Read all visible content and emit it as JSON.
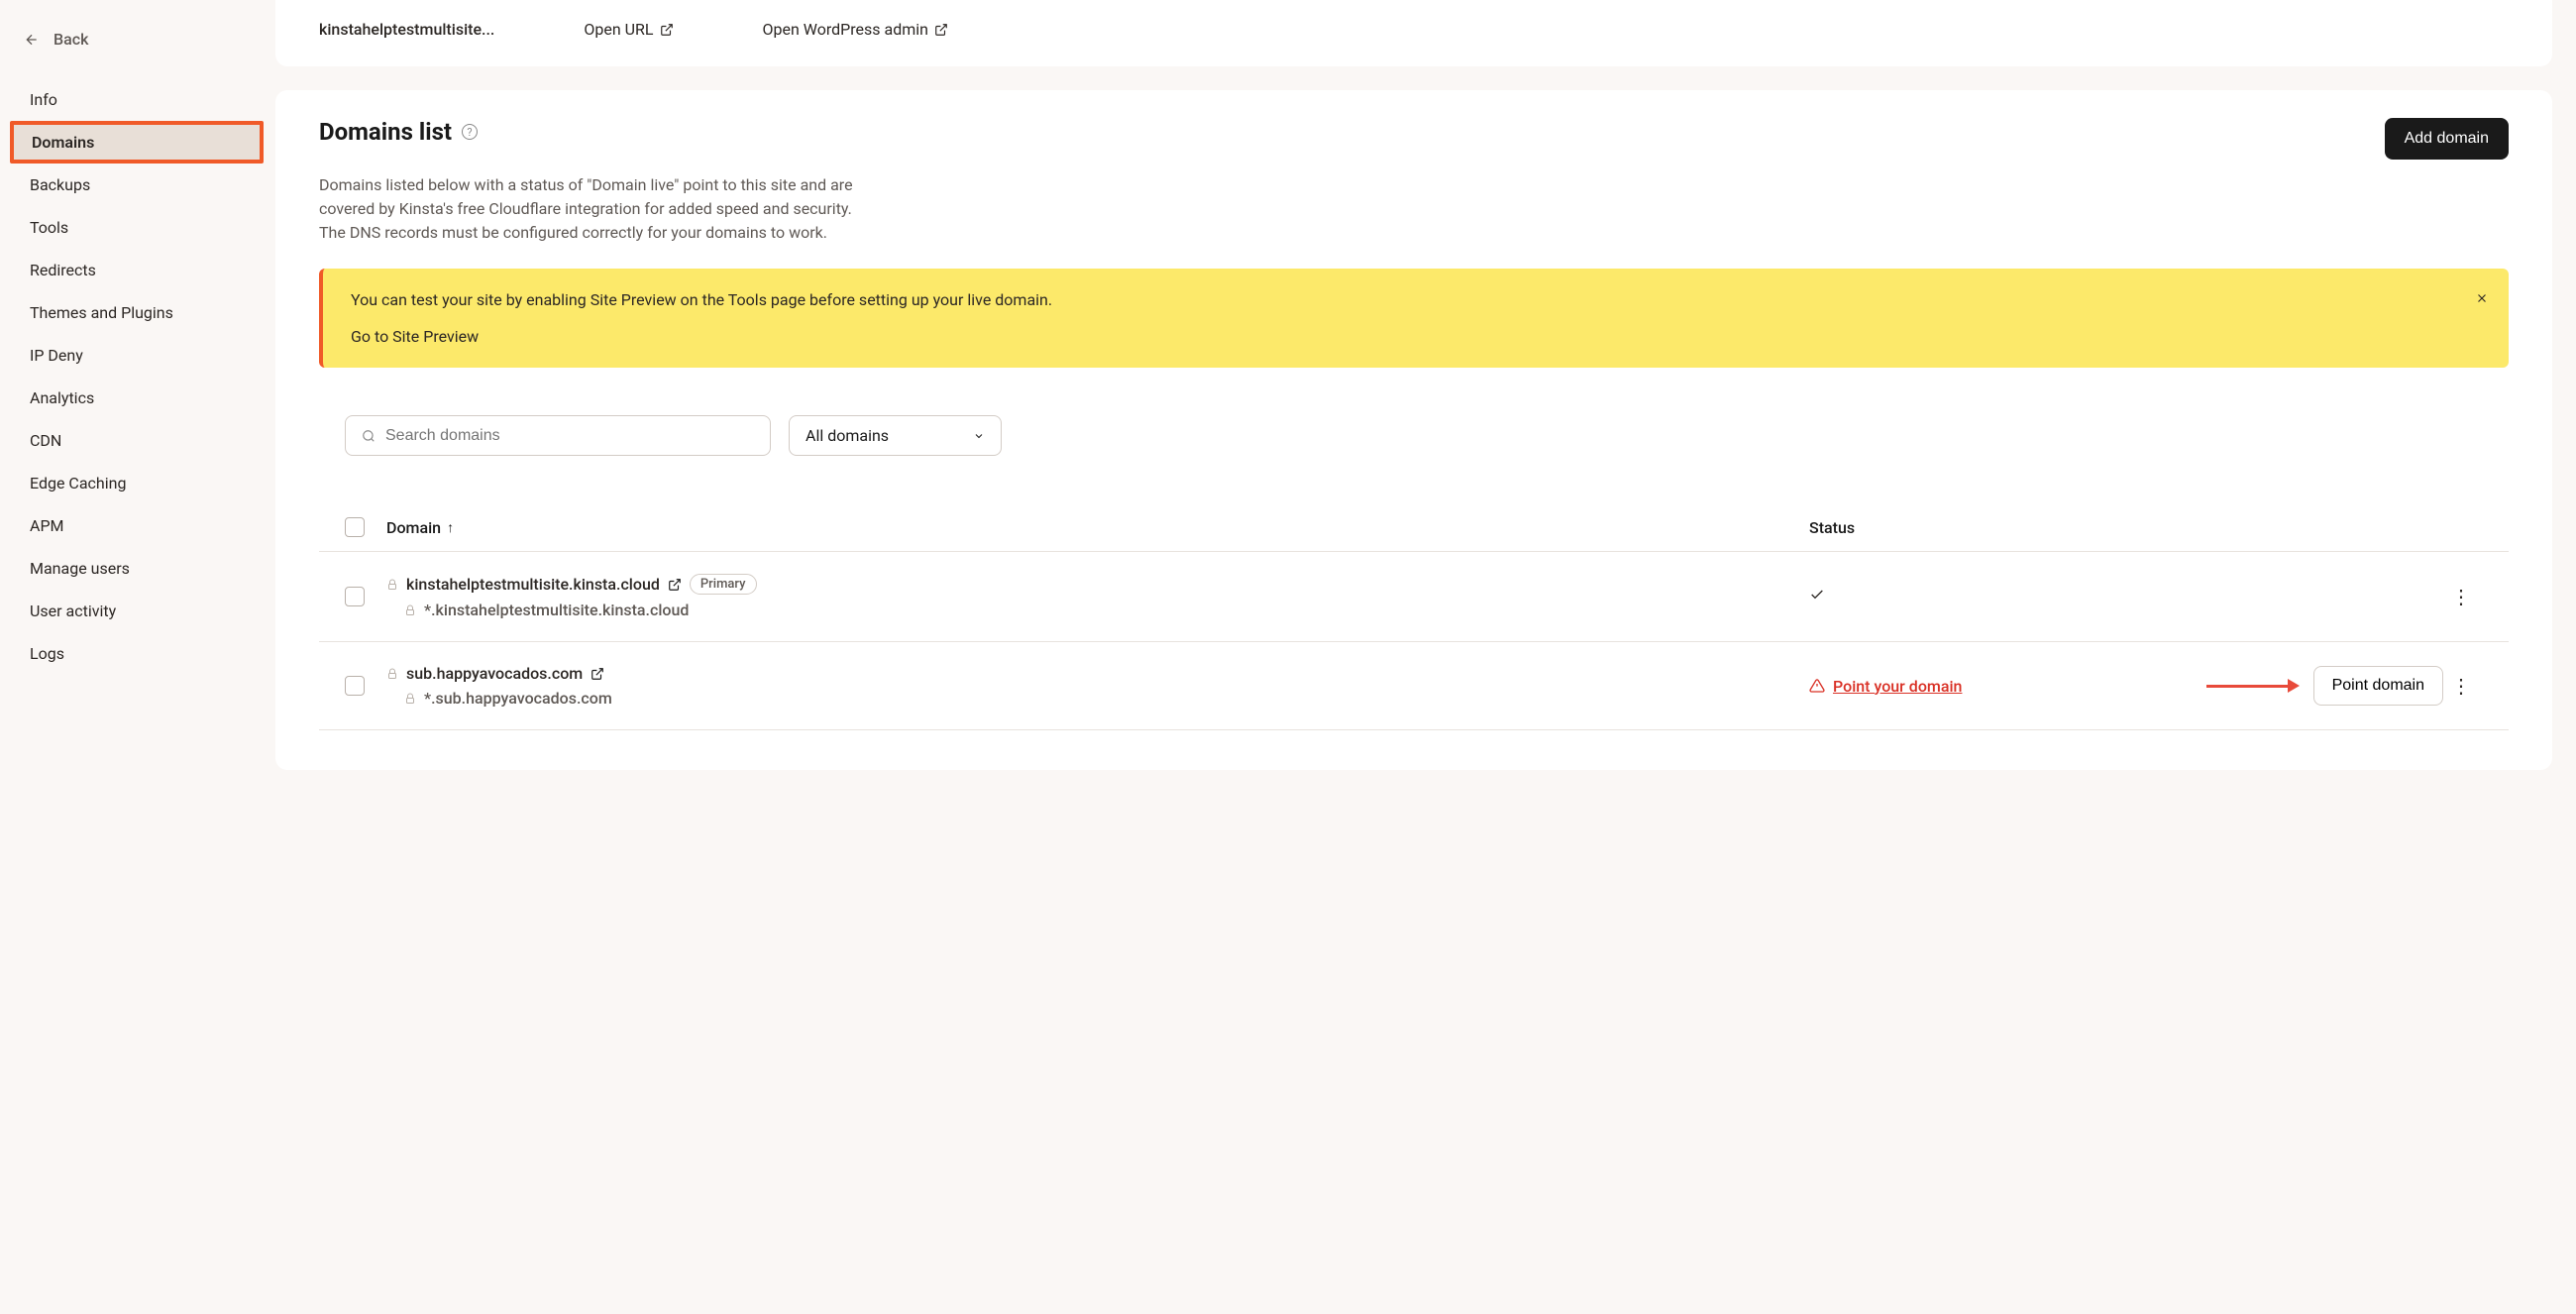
{
  "back_label": "Back",
  "sidebar": {
    "items": [
      {
        "label": "Info"
      },
      {
        "label": "Domains"
      },
      {
        "label": "Backups"
      },
      {
        "label": "Tools"
      },
      {
        "label": "Redirects"
      },
      {
        "label": "Themes and Plugins"
      },
      {
        "label": "IP Deny"
      },
      {
        "label": "Analytics"
      },
      {
        "label": "CDN"
      },
      {
        "label": "Edge Caching"
      },
      {
        "label": "APM"
      },
      {
        "label": "Manage users"
      },
      {
        "label": "User activity"
      },
      {
        "label": "Logs"
      }
    ]
  },
  "top_bar": {
    "site_name": "kinstahelptestmultisite...",
    "open_url": "Open URL",
    "open_admin": "Open WordPress admin"
  },
  "page": {
    "title": "Domains list",
    "add_button": "Add domain",
    "description": "Domains listed below with a status of \"Domain live\" point to this site and are covered by Kinsta's free Cloudflare integration for added speed and security. The DNS records must be configured correctly for your domains to work."
  },
  "alert": {
    "text": "You can test your site by enabling Site Preview on the Tools page before setting up your live domain.",
    "link": "Go to Site Preview"
  },
  "controls": {
    "search_placeholder": "Search domains",
    "filter_label": "All domains"
  },
  "table": {
    "col_domain": "Domain",
    "col_status": "Status",
    "rows": [
      {
        "domain": "kinstahelptestmultisite.kinsta.cloud",
        "wildcard": "*.kinstahelptestmultisite.kinsta.cloud",
        "badge": "Primary",
        "status_type": "live"
      },
      {
        "domain": "sub.happyavocados.com",
        "wildcard": "*.sub.happyavocados.com",
        "status_type": "warn",
        "status_text": "Point your domain",
        "action_label": "Point domain"
      }
    ]
  }
}
